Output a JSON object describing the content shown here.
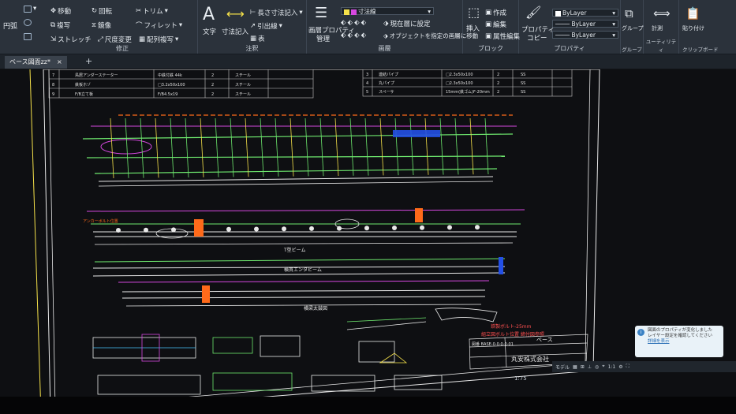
{
  "ribbon": {
    "modify": {
      "group_label": "修正",
      "move": "移動",
      "rotate": "回転",
      "trim": "トリム",
      "copy": "複写",
      "mirror": "鏡像",
      "fillet": "フィレット",
      "stretch": "ストレッチ",
      "scale": "尺度変更",
      "array": "配列複写"
    },
    "draw": {
      "circle": "円弧"
    },
    "annotation": {
      "group_label": "注釈",
      "text": "文字",
      "dimension": "寸法記入",
      "linear": "長さ寸法記入",
      "leader": "引出線",
      "table": "表"
    },
    "layers": {
      "group_label": "画層",
      "properties": "画層プロパティ",
      "manage": "管理",
      "current_layer": "寸法線",
      "set_current": "現在層に設定",
      "move_to_layer": "オブジェクトを指定の画層に移動"
    },
    "block": {
      "group_label": "ブロック",
      "insert": "挿入",
      "create": "作成",
      "edit": "編集",
      "edit_attributes": "属性編集"
    },
    "properties": {
      "group_label": "プロパティ",
      "match": "プロパティ",
      "copy": "コピー",
      "color": "ByLayer",
      "linetype": "ByLayer",
      "lineweight": "ByLayer"
    },
    "groups": {
      "group_label": "グループ",
      "group": "グループ"
    },
    "utilities": {
      "group_label": "ユーティリティ",
      "measure": "計測"
    },
    "clipboard": {
      "group_label": "クリップボード",
      "paste": "貼り付け"
    }
  },
  "tabs": {
    "document": "ベース図面zz*",
    "close": "×",
    "add": "+"
  },
  "drawing": {
    "bom_left": [
      {
        "no": "7",
        "name": "鳥居アンダーステーター",
        "spec": "中鉄付鉄 44k",
        "qty": "2",
        "mat": "スチール"
      },
      {
        "no": "8",
        "name": "鉄板ホゾ",
        "spec": "□3.2x50x100",
        "qty": "2",
        "mat": "スチール"
      },
      {
        "no": "9",
        "name": "F/B立て板",
        "spec": "F/B4.5x19",
        "qty": "2",
        "mat": "スチール"
      }
    ],
    "bom_right": [
      {
        "no": "3",
        "name": "連結パイプ",
        "spec": "□2.3x50x100",
        "qty": "2",
        "mat": "SS"
      },
      {
        "no": "4",
        "name": "丸パイプ",
        "spec": "□2.3x50x100",
        "qty": "2",
        "mat": "SS"
      },
      {
        "no": "5",
        "name": "スペーサ",
        "spec": "15mm(鉄ゴム)F-20mm",
        "qty": "2",
        "mat": "SS"
      }
    ],
    "label_frame": "T型ビーム",
    "label_rail": "横貫エンタビーム",
    "label_section": "横梁太鼓図",
    "label_left_anchor": "アンカーボルト位置",
    "note_top": "鉄製ボルト-25mm",
    "note_mid": "組立図ボルト位置 締付図参照",
    "title_drawing": "ベース",
    "title_company": "丸安株式会社",
    "title_id": "図番 BASE-0-0-0-0-01"
  },
  "notification": {
    "icon": "i",
    "line1": "図面のプロパティが変化しました",
    "line2": "レイヤー設定を確認してください",
    "line3": "詳細を表示"
  },
  "status": {
    "scale": "1:75",
    "coords": "1:1",
    "model": "モデル"
  },
  "colors": {
    "ribbon": "#2b323b",
    "canvas": "#0e0f12",
    "frame": "#e8e8e8",
    "magenta": "#d648e0",
    "green": "#6ee86e",
    "cyan": "#49c6ff",
    "orange": "#ff6a1a",
    "yellow": "#f5e14a"
  }
}
